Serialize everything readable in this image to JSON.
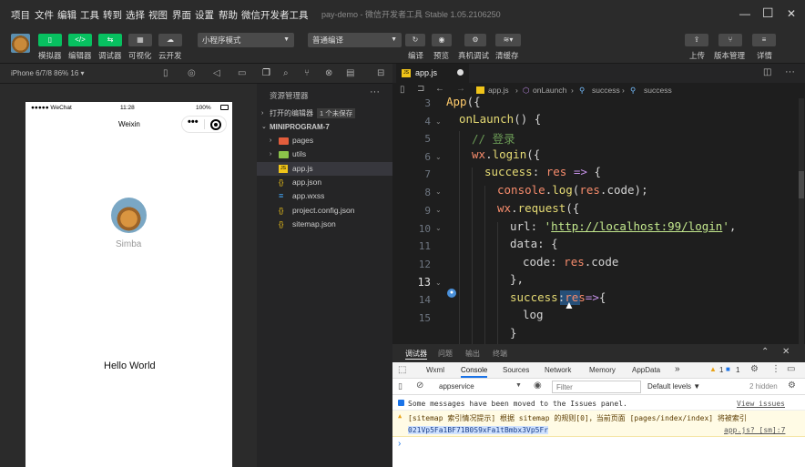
{
  "menubar": {
    "items": [
      "项目",
      "文件",
      "编辑",
      "工具",
      "转到",
      "选择",
      "视图",
      "界面",
      "设置",
      "帮助",
      "微信开发者工具"
    ],
    "title": "pay-demo - 微信开发者工具 Stable 1.05.2106250"
  },
  "toolbar": {
    "simulator": "模拟器",
    "editor": "编辑器",
    "debugger": "调试器",
    "visual": "可视化",
    "cloud": "云开发",
    "mode_select": "小程序模式",
    "compile_select": "普通编译",
    "compile": "编译",
    "preview": "预览",
    "remote_debug": "真机调试",
    "clear_cache": "清缓存",
    "upload": "上传",
    "version": "版本管理",
    "details": "详情"
  },
  "simulator": {
    "device": "iPhone 6/7/8 86% 16 ▾",
    "status_left": "●●●●● WeChat",
    "status_time": "11:28",
    "status_right": "100%",
    "nav_title": "Weixin",
    "capsule": "•••",
    "username": "Simba",
    "hello": "Hello World"
  },
  "explorer": {
    "header": "资源管理器",
    "open_editors": "打开的编辑器",
    "unsaved_badge": "1 个未保存",
    "project": "MINIPROGRAM-7",
    "items": [
      {
        "name": "pages",
        "type": "folder"
      },
      {
        "name": "utils",
        "type": "folder"
      },
      {
        "name": "app.js",
        "type": "js"
      },
      {
        "name": "app.json",
        "type": "json"
      },
      {
        "name": "app.wxss",
        "type": "wxss"
      },
      {
        "name": "project.config.json",
        "type": "json"
      },
      {
        "name": "sitemap.json",
        "type": "json"
      }
    ]
  },
  "editor": {
    "tab": "app.js",
    "breadcrumb": [
      "app.js",
      "onLaunch",
      "success",
      "success"
    ],
    "line_numbers": [
      "3",
      "4",
      "5",
      "6",
      "7",
      "8",
      "9",
      "10",
      "11",
      "12",
      "13",
      "14",
      "15"
    ]
  },
  "debug": {
    "panel_tabs": [
      "调试器",
      "问题",
      "输出",
      "终端"
    ],
    "devtools_tabs": [
      "Wxml",
      "Console",
      "Sources",
      "Network",
      "Memory",
      "AppData"
    ],
    "more": "»",
    "warn_count": "1",
    "info_count": "1",
    "context": "appservice",
    "filter_placeholder": "Filter",
    "levels": "Default levels ▼",
    "hidden": "2 hidden",
    "messages": [
      {
        "type": "info",
        "text": "Some messages have been moved to the Issues panel.",
        "link": "View issues"
      },
      {
        "type": "warn",
        "text": "[sitemap 索引情况提示] 根据 sitemap 的规则[0]，当前页面 [pages/index/index] 将被索引",
        "link": "app.js? [sm]:7"
      },
      {
        "type": "log",
        "text": "021Vp5Fa1BF71B0S9xFa1tBmbx3Vp5Fr",
        "link": ""
      }
    ],
    "prompt": "›"
  },
  "colors": {
    "accent": "#07c160",
    "warn_bg": "#fffbe5",
    "selection": "#37373d"
  }
}
